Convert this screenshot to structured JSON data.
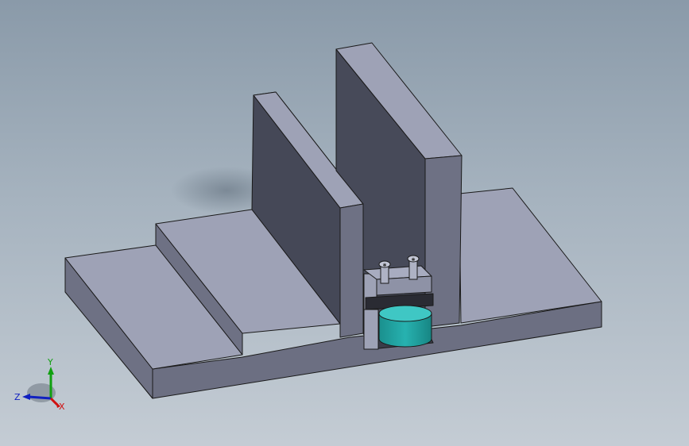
{
  "viewport": {
    "background_top": "#8a9aa9",
    "background_bottom": "#c4ccd4"
  },
  "model": {
    "face_top": "#9ea2b6",
    "face_front": "#6e7184",
    "face_side": "#474a59",
    "face_dark": "#3a3c48",
    "edge": "#1a1a1a",
    "cylinder_top": "#3fc7c4",
    "cylinder_side": "#1fa3a1",
    "screw_icon": "hex-socket-screw"
  },
  "triad": {
    "x_label": "X",
    "y_label": "Y",
    "z_label": "Z",
    "x_color": "#d01010",
    "y_color": "#10a010",
    "z_color": "#1020c0"
  }
}
